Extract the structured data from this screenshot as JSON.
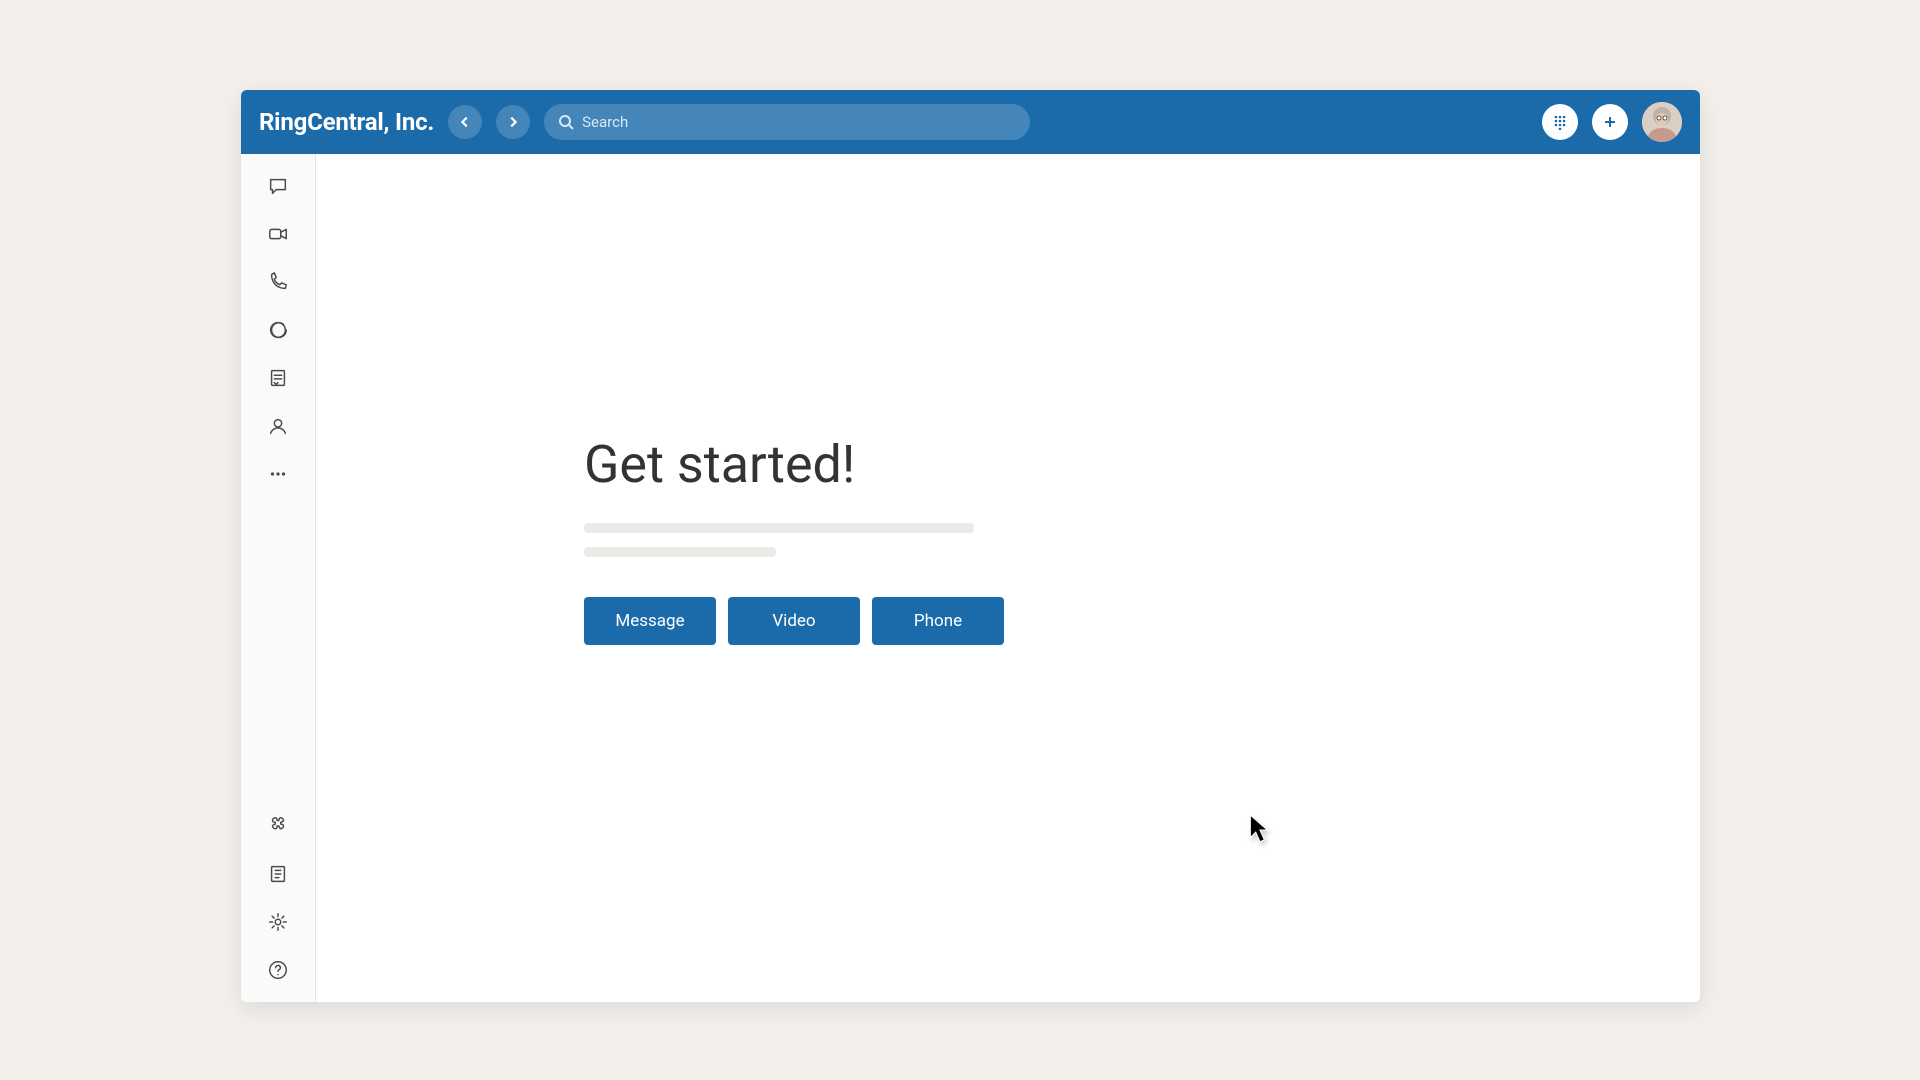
{
  "header": {
    "app_title": "RingCentral, Inc.",
    "search_placeholder": "Search",
    "icons": {
      "back": "chevron-left",
      "forward": "chevron-right",
      "dialpad": "dialpad",
      "add": "plus",
      "avatar": "user-avatar"
    }
  },
  "sidebar": {
    "top_items": [
      {
        "name": "message-icon"
      },
      {
        "name": "video-icon"
      },
      {
        "name": "phone-icon"
      },
      {
        "name": "text-icon"
      },
      {
        "name": "fax-icon"
      },
      {
        "name": "contacts-icon"
      },
      {
        "name": "more-icon"
      }
    ],
    "bottom_items": [
      {
        "name": "apps-icon"
      },
      {
        "name": "resource-icon"
      },
      {
        "name": "settings-icon"
      },
      {
        "name": "help-icon"
      }
    ]
  },
  "main": {
    "heading": "Get started!",
    "buttons": [
      {
        "label": "Message"
      },
      {
        "label": "Video"
      },
      {
        "label": "Phone"
      }
    ]
  },
  "colors": {
    "primary": "#1b6bab",
    "page_bg": "#f3f0ec"
  }
}
